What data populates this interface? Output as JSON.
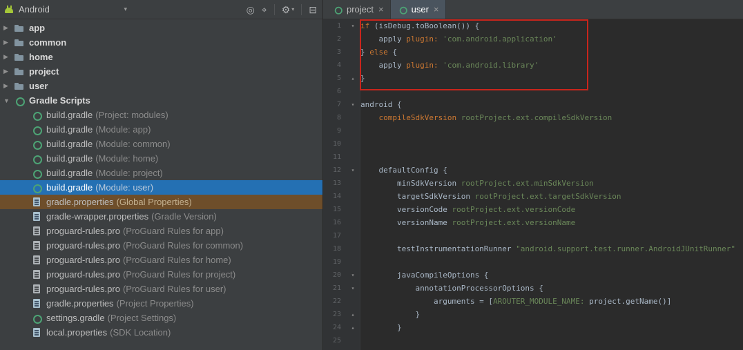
{
  "colors": {
    "panel_bg": "#3c3f41",
    "editor_bg": "#2b2b2b",
    "gutter_bg": "#313335",
    "selection_blue": "#2470b3",
    "highlight_brown": "#6e4e2a",
    "annotation_red": "#c9251c",
    "keyword_orange": "#cc7832",
    "string_green": "#6a8759",
    "code_default": "#a9b7c6",
    "active_tab_bg": "#4a545e"
  },
  "panel": {
    "header": {
      "view_selector": {
        "label": "Android",
        "caret": "▾"
      },
      "icons": [
        {
          "name": "locate-icon",
          "glyph": "◎"
        },
        {
          "name": "collapse-all-icon",
          "glyph": "⌖"
        },
        {
          "name": "settings-gear-icon",
          "glyph": "⚙",
          "caret": "▾"
        },
        {
          "name": "hide-panel-icon",
          "glyph": "⊟"
        }
      ]
    },
    "tree": [
      {
        "level": 0,
        "arrow": "▶",
        "icon": "folder",
        "label": "app",
        "bold": true
      },
      {
        "level": 0,
        "arrow": "▶",
        "icon": "folder",
        "label": "common",
        "bold": true
      },
      {
        "level": 0,
        "arrow": "▶",
        "icon": "folder",
        "label": "home",
        "bold": true
      },
      {
        "level": 0,
        "arrow": "▶",
        "icon": "folder",
        "label": "project",
        "bold": true
      },
      {
        "level": 0,
        "arrow": "▶",
        "icon": "folder",
        "label": "user",
        "bold": true
      },
      {
        "level": 0,
        "arrow": "▼",
        "icon": "gradle",
        "label": "Gradle Scripts",
        "bold": true
      },
      {
        "level": 1,
        "icon": "gradle",
        "label": "build.gradle",
        "suffix": "(Project: modules)"
      },
      {
        "level": 1,
        "icon": "gradle",
        "label": "build.gradle",
        "suffix": "(Module: app)"
      },
      {
        "level": 1,
        "icon": "gradle",
        "label": "build.gradle",
        "suffix": "(Module: common)"
      },
      {
        "level": 1,
        "icon": "gradle",
        "label": "build.gradle",
        "suffix": "(Module: home)"
      },
      {
        "level": 1,
        "icon": "gradle",
        "label": "build.gradle",
        "suffix": "(Module: project)"
      },
      {
        "level": 1,
        "icon": "gradle",
        "label": "build.gradle",
        "suffix": "(Module: user)",
        "state": "selected"
      },
      {
        "level": 1,
        "icon": "props",
        "label": "gradle.properties",
        "suffix": "(Global Properties)",
        "state": "highlighted"
      },
      {
        "level": 1,
        "icon": "props",
        "label": "gradle-wrapper.properties",
        "suffix": "(Gradle Version)"
      },
      {
        "level": 1,
        "icon": "pro",
        "label": "proguard-rules.pro",
        "suffix": "(ProGuard Rules for app)"
      },
      {
        "level": 1,
        "icon": "pro",
        "label": "proguard-rules.pro",
        "suffix": "(ProGuard Rules for common)"
      },
      {
        "level": 1,
        "icon": "pro",
        "label": "proguard-rules.pro",
        "suffix": "(ProGuard Rules for home)"
      },
      {
        "level": 1,
        "icon": "pro",
        "label": "proguard-rules.pro",
        "suffix": "(ProGuard Rules for project)"
      },
      {
        "level": 1,
        "icon": "pro",
        "label": "proguard-rules.pro",
        "suffix": "(ProGuard Rules for user)"
      },
      {
        "level": 1,
        "icon": "props",
        "label": "gradle.properties",
        "suffix": "(Project Properties)"
      },
      {
        "level": 1,
        "icon": "gradle",
        "label": "settings.gradle",
        "suffix": "(Project Settings)"
      },
      {
        "level": 1,
        "icon": "props",
        "label": "local.properties",
        "suffix": "(SDK Location)"
      }
    ]
  },
  "editor": {
    "tabs": [
      {
        "label": "project",
        "icon": "gradle",
        "close": "×",
        "active": false
      },
      {
        "label": "user",
        "icon": "gradle",
        "close": "×",
        "active": true
      }
    ],
    "code": {
      "lines": [
        {
          "n": "1",
          "fold": "open",
          "segs": [
            [
              "o",
              "if "
            ],
            [
              "w",
              "(isDebug.toBoolean()) {"
            ]
          ]
        },
        {
          "n": "2",
          "segs": [
            [
              "w",
              "    apply "
            ],
            [
              "o",
              "plugin:"
            ],
            [
              "g",
              " 'com.android.application'"
            ]
          ]
        },
        {
          "n": "3",
          "segs": [
            [
              "w",
              "} "
            ],
            [
              "o",
              "else"
            ],
            [
              "w",
              " {"
            ]
          ]
        },
        {
          "n": "4",
          "segs": [
            [
              "w",
              "    apply "
            ],
            [
              "o",
              "plugin:"
            ],
            [
              "g",
              " 'com.android.library'"
            ]
          ]
        },
        {
          "n": "5",
          "fold": "close",
          "segs": [
            [
              "w",
              "}"
            ]
          ]
        },
        {
          "n": "6",
          "segs": []
        },
        {
          "n": "7",
          "fold": "open",
          "segs": [
            [
              "w",
              "android {"
            ]
          ]
        },
        {
          "n": "8",
          "segs": [
            [
              "o",
              "    compileSdkVersion "
            ],
            [
              "g",
              "rootProject.ext.compileSdkVersion"
            ]
          ]
        },
        {
          "n": "9",
          "segs": []
        },
        {
          "n": "10",
          "segs": []
        },
        {
          "n": "11",
          "segs": []
        },
        {
          "n": "12",
          "fold": "open",
          "segs": [
            [
              "w",
              "    defaultConfig {"
            ]
          ]
        },
        {
          "n": "13",
          "segs": [
            [
              "w",
              "        minSdkVersion "
            ],
            [
              "g",
              "rootProject.ext.minSdkVersion"
            ]
          ]
        },
        {
          "n": "14",
          "segs": [
            [
              "w",
              "        targetSdkVersion "
            ],
            [
              "g",
              "rootProject.ext.targetSdkVersion"
            ]
          ]
        },
        {
          "n": "15",
          "segs": [
            [
              "w",
              "        versionCode "
            ],
            [
              "g",
              "rootProject.ext.versionCode"
            ]
          ]
        },
        {
          "n": "16",
          "segs": [
            [
              "w",
              "        versionName "
            ],
            [
              "g",
              "rootProject.ext.versionName"
            ]
          ]
        },
        {
          "n": "17",
          "segs": []
        },
        {
          "n": "18",
          "segs": [
            [
              "w",
              "        testInstrumentationRunner "
            ],
            [
              "g",
              "\"android.support.test.runner.AndroidJUnitRunner\""
            ]
          ]
        },
        {
          "n": "19",
          "segs": []
        },
        {
          "n": "20",
          "fold": "open",
          "segs": [
            [
              "w",
              "        javaCompileOptions {"
            ]
          ]
        },
        {
          "n": "21",
          "fold": "open",
          "segs": [
            [
              "w",
              "            annotationProcessorOptions {"
            ]
          ]
        },
        {
          "n": "22",
          "segs": [
            [
              "w",
              "                arguments = ["
            ],
            [
              "g",
              "AROUTER_MODULE_NAME:"
            ],
            [
              "w",
              " project.getName()]"
            ]
          ]
        },
        {
          "n": "23",
          "fold": "close",
          "segs": [
            [
              "w",
              "            }"
            ]
          ]
        },
        {
          "n": "24",
          "fold": "close",
          "segs": [
            [
              "w",
              "        }"
            ]
          ]
        },
        {
          "n": "25",
          "segs": []
        }
      ]
    }
  }
}
